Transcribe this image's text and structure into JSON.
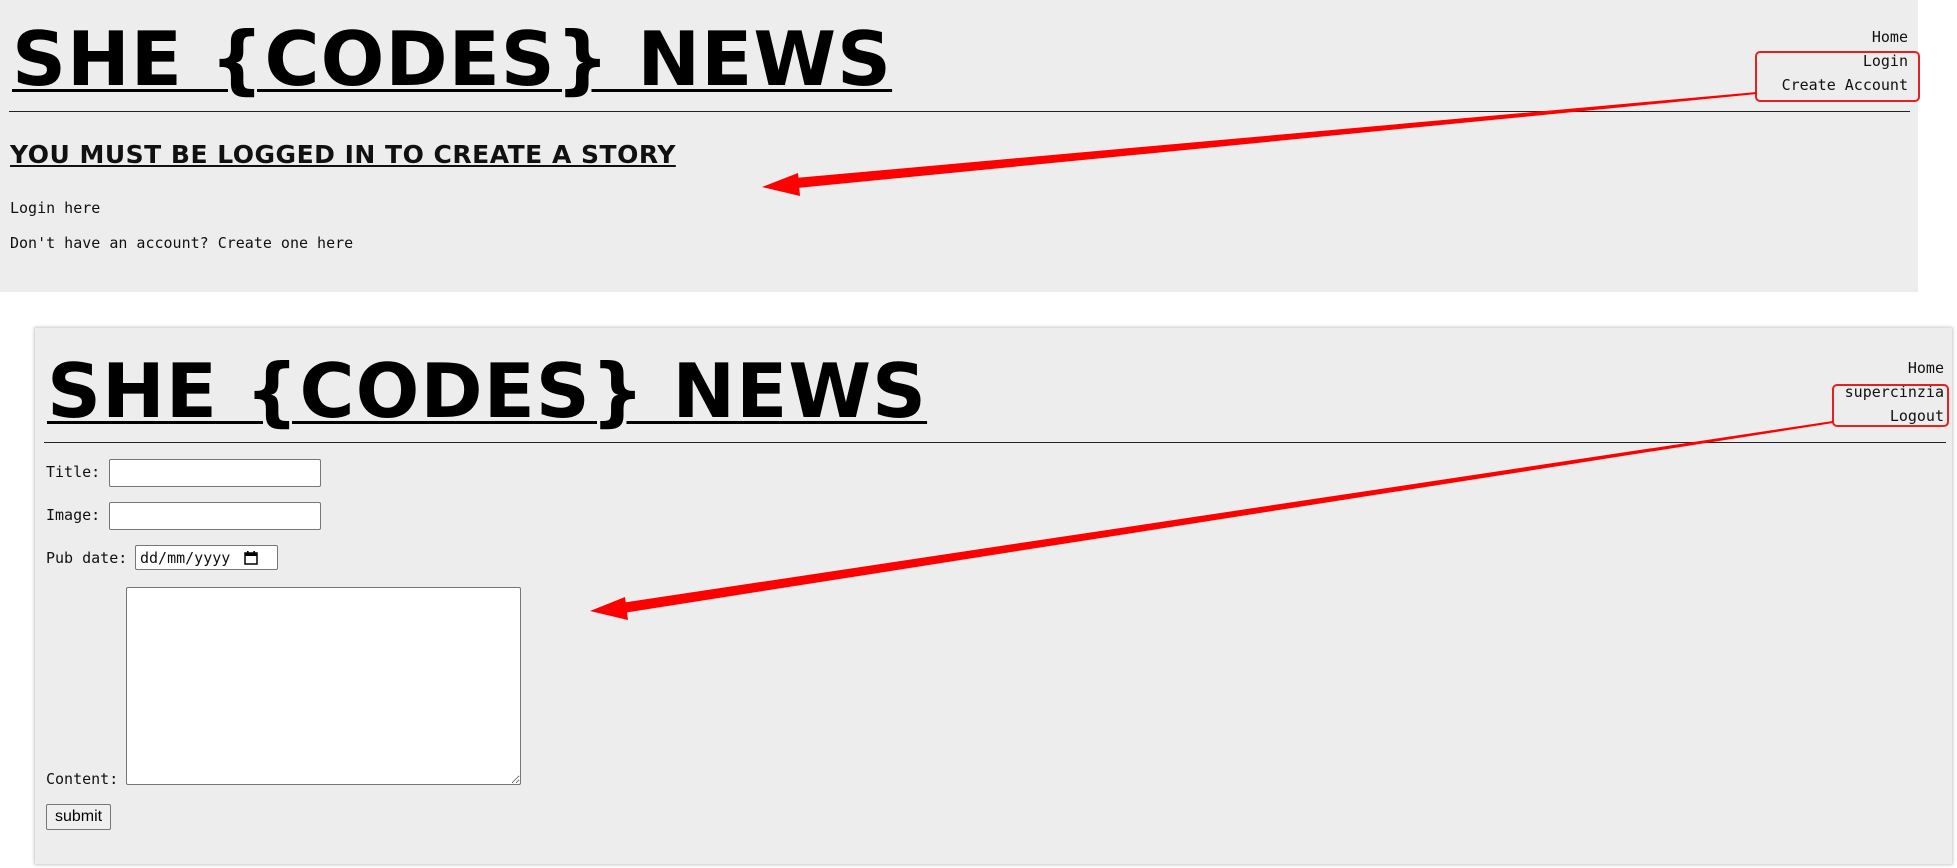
{
  "top_panel": {
    "site_title": "SHE {CODES} NEWS",
    "nav": {
      "home": "Home",
      "login": "Login",
      "create_account": "Create Account"
    },
    "heading": "YOU MUST BE LOGGED IN TO CREATE A STORY",
    "login_line": "Login here",
    "signup_line": "Don't have an account? Create one here"
  },
  "bottom_panel": {
    "site_title": "SHE {CODES} NEWS",
    "nav": {
      "home": "Home",
      "username": "supercinzia",
      "logout": "Logout"
    },
    "form": {
      "title_label": "Title:",
      "image_label": "Image:",
      "pub_date_label": "Pub date:",
      "pub_date_placeholder": "dd/mm/yyyy",
      "content_label": "Content:",
      "submit_label": "submit"
    }
  },
  "annotation": {
    "highlight_color": "#e42020",
    "arrow_color": "#ff0000"
  }
}
